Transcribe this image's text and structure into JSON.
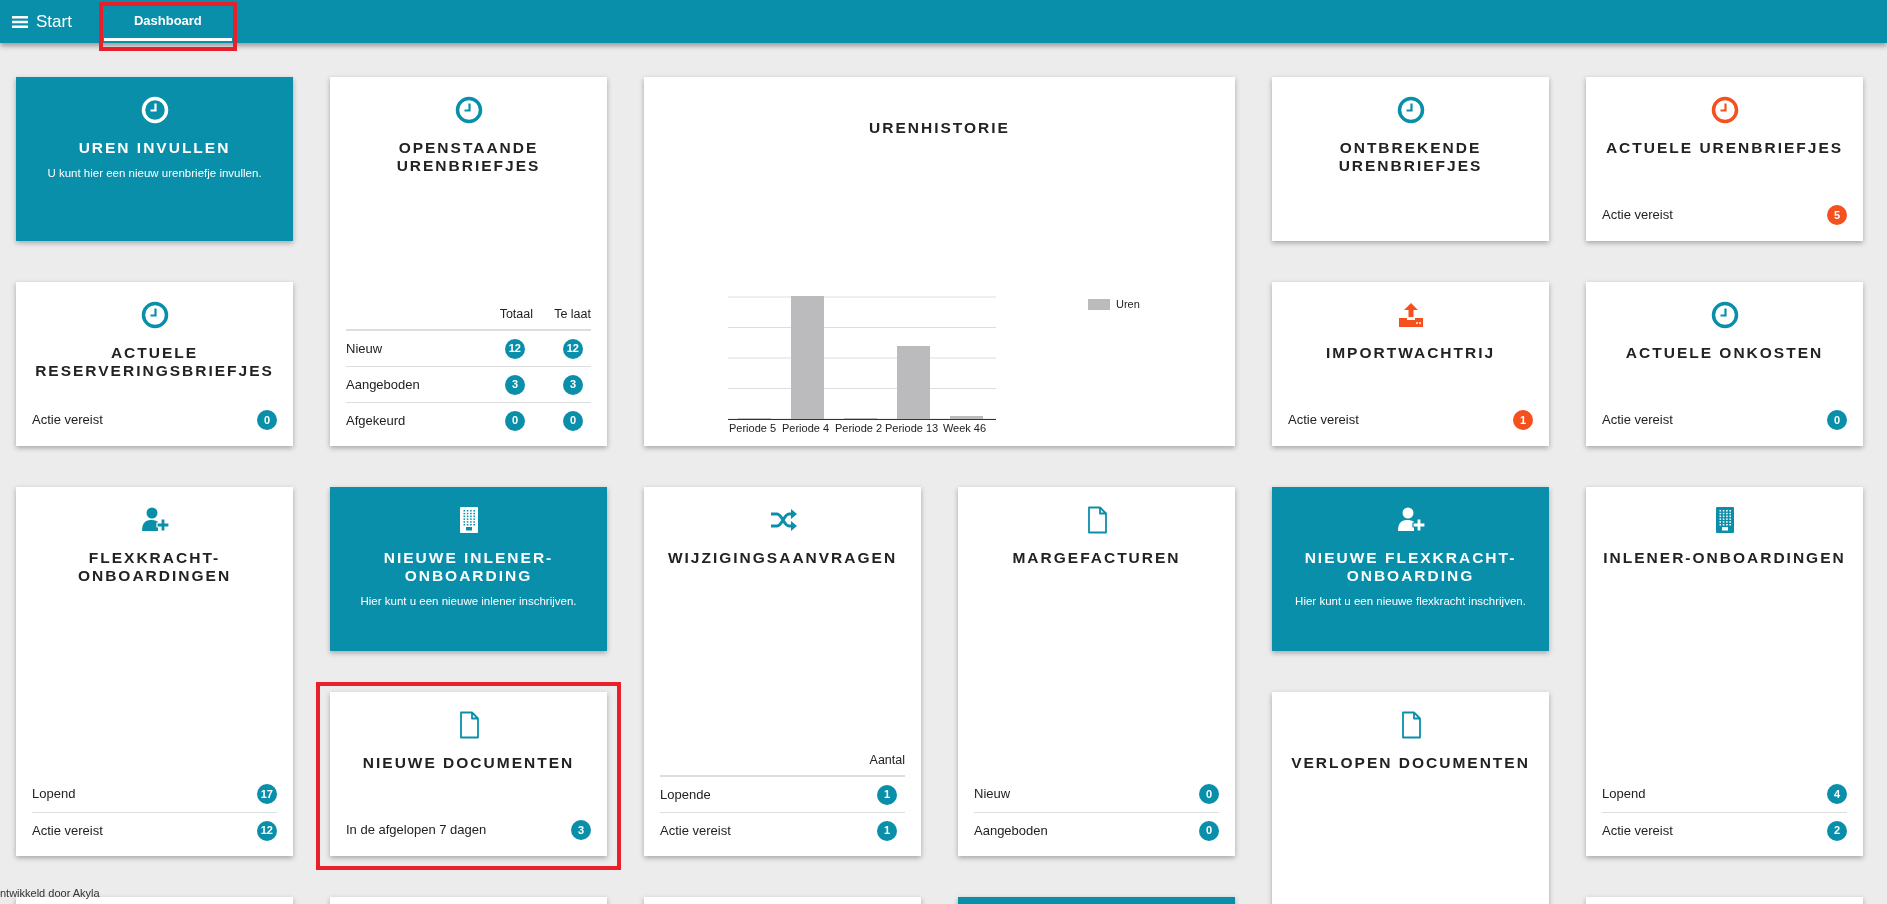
{
  "topbar": {
    "menu_label": "Start",
    "tabs": [
      {
        "label": "Dashboard",
        "selected": true,
        "highlighted": true
      }
    ]
  },
  "tiles": [
    {
      "kind": "action",
      "filled": true,
      "title": "UREN INVULLEN",
      "subtitle": "U kunt hier een nieuw urenbriefje invullen."
    },
    {
      "kind": "list",
      "filled": false,
      "color": "#0a8fab",
      "title": "OPENSTAANDE URENBRIEFJES",
      "columns": [
        "Totaal",
        "Te laat"
      ],
      "rows": [
        {
          "label": "Nieuw",
          "values": [
            "12",
            "12"
          ],
          "color": "#0a8fab"
        },
        {
          "label": "Aangeboden",
          "values": [
            "3",
            "3"
          ],
          "color": "#0a8fab"
        },
        {
          "label": "Afgekeurd",
          "values": [
            "0",
            "0"
          ],
          "color": "#0a8fab"
        }
      ]
    },
    {
      "kind": "chart",
      "filled": false,
      "title": "URENHISTORIE",
      "legend": "Uren",
      "categories": [
        "Periode 5",
        "Periode 4",
        "Periode 2",
        "Periode 13",
        "Week 46"
      ]
    },
    {
      "kind": "list",
      "filled": false,
      "color": "#0a8fab",
      "title": "ONTBREKENDE URENBRIEFJES"
    },
    {
      "kind": "list",
      "filled": false,
      "color": "#f4511e",
      "title": "ACTUELE URENBRIEFJES",
      "rows": [
        {
          "label": "Actie vereist",
          "values": [
            "5"
          ],
          "color": "#f4511e"
        }
      ]
    },
    {
      "kind": "list",
      "filled": false,
      "color": "#0a8fab",
      "title": "ACTUELE RESERVERINGSBRIEFJES",
      "rows": [
        {
          "label": "Actie vereist",
          "values": [
            "0"
          ],
          "color": "#0a8fab"
        }
      ]
    },
    {
      "kind": "list",
      "filled": false,
      "color": "#f4511e",
      "title": "IMPORTWACHTRIJ",
      "rows": [
        {
          "label": "Actie vereist",
          "values": [
            "1"
          ],
          "color": "#f4511e"
        }
      ]
    },
    {
      "kind": "list",
      "filled": false,
      "color": "#0a8fab",
      "title": "ACTUELE ONKOSTEN",
      "rows": [
        {
          "label": "Actie vereist",
          "values": [
            "0"
          ],
          "color": "#0a8fab"
        }
      ]
    },
    {
      "kind": "list",
      "filled": false,
      "color": "#0a8fab",
      "title": "FLEXKRACHT-ONBOARDINGEN",
      "rows": [
        {
          "label": "Lopend",
          "values": [
            "17"
          ],
          "color": "#0a8fab"
        },
        {
          "label": "Actie vereist",
          "values": [
            "12"
          ],
          "color": "#0a8fab"
        }
      ]
    },
    {
      "kind": "action",
      "filled": true,
      "title": "NIEUWE INLENER-ONBOARDING",
      "subtitle": "Hier kunt u een nieuwe inlener inschrijven."
    },
    {
      "kind": "list",
      "filled": false,
      "highlighted": true,
      "color": "#0a8fab",
      "title": "NIEUWE DOCUMENTEN",
      "rows": [
        {
          "label": "In de afgelopen 7 dagen",
          "values": [
            "3"
          ],
          "color": "#0a8fab"
        }
      ]
    },
    {
      "kind": "list",
      "filled": false,
      "color": "#0a8fab",
      "title": "WIJZIGINGSAANVRAGEN",
      "columns": [
        "Aantal"
      ],
      "rows": [
        {
          "label": "Lopende",
          "values": [
            "1"
          ],
          "color": "#0a8fab"
        },
        {
          "label": "Actie vereist",
          "values": [
            "1"
          ],
          "color": "#0a8fab"
        }
      ]
    },
    {
      "kind": "list",
      "filled": false,
      "color": "#0a8fab",
      "title": "MARGEFACTUREN",
      "rows": [
        {
          "label": "Nieuw",
          "values": [
            "0"
          ],
          "color": "#0a8fab"
        },
        {
          "label": "Aangeboden",
          "values": [
            "0"
          ],
          "color": "#0a8fab"
        }
      ]
    },
    {
      "kind": "action",
      "filled": true,
      "title": "NIEUWE FLEXKRACHT-ONBOARDING",
      "subtitle": "Hier kunt u een nieuwe flexkracht inschrijven."
    },
    {
      "kind": "list",
      "filled": false,
      "color": "#0a8fab",
      "title": "VERLOPEN DOCUMENTEN"
    },
    {
      "kind": "list",
      "filled": false,
      "color": "#0a8fab",
      "title": "INLENER-ONBOARDINGEN",
      "rows": [
        {
          "label": "Lopend",
          "values": [
            "4"
          ],
          "color": "#0a8fab"
        },
        {
          "label": "Actie vereist",
          "values": [
            "2"
          ],
          "color": "#0a8fab"
        }
      ]
    },
    {
      "kind": "blank",
      "filled": false
    },
    {
      "kind": "blank",
      "filled": false
    },
    {
      "kind": "blank",
      "filled": false
    },
    {
      "kind": "blank",
      "filled": true
    },
    {
      "kind": "blank",
      "filled": false
    }
  ],
  "footer": "ntwikkeld door Akyla"
}
